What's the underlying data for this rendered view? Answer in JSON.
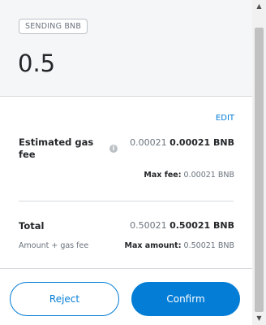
{
  "header": {
    "badge": "SENDING BNB",
    "amount": "0.5"
  },
  "details": {
    "edit_label": "EDIT",
    "gas": {
      "label": "Estimated gas fee",
      "value_muted": "0.00021",
      "value_strong": "0.00021 BNB",
      "max_fee_label": "Max fee:",
      "max_fee_value": "0.00021 BNB",
      "info_icon": "info-icon"
    },
    "total": {
      "label": "Total",
      "value_muted": "0.50021",
      "value_strong": "0.50021 BNB",
      "sub_label": "Amount + gas fee",
      "max_amount_label": "Max amount:",
      "max_amount_value": "0.50021 BNB"
    }
  },
  "footer": {
    "reject_label": "Reject",
    "confirm_label": "Confirm"
  },
  "colors": {
    "accent": "#037dd6",
    "header_bg": "#f5f6f7",
    "text": "#24272a",
    "muted": "#6a737d"
  }
}
